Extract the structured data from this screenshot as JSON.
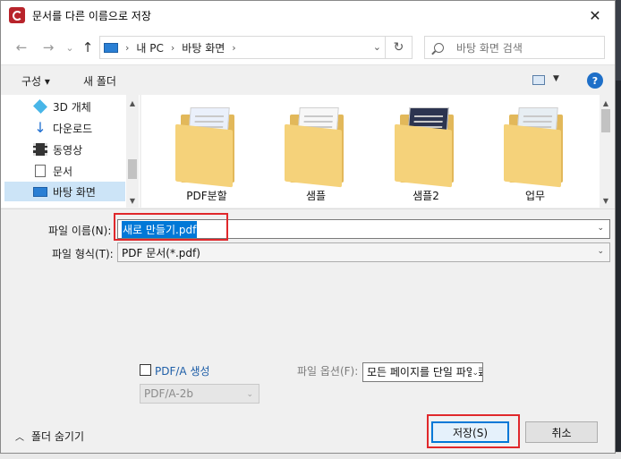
{
  "window": {
    "title": "문서를 다른 이름으로 저장",
    "close": "✕"
  },
  "nav": {
    "back": "←",
    "forward": "→",
    "recent": "⌄",
    "up": "↑",
    "breadcrumb": [
      "내 PC",
      "바탕 화면"
    ],
    "breadcrumb_sep": "›",
    "refresh": "↻",
    "search_placeholder": "바탕 화면 검색"
  },
  "toolbar": {
    "organize_label": "구성 ▾",
    "new_folder_label": "새 폴더",
    "help": "?"
  },
  "sidebar": {
    "items": [
      {
        "label": "3D 개체",
        "icon": "3d-objects-icon"
      },
      {
        "label": "다운로드",
        "icon": "download-icon"
      },
      {
        "label": "동영상",
        "icon": "video-icon"
      },
      {
        "label": "문서",
        "icon": "document-icon"
      },
      {
        "label": "바탕 화면",
        "icon": "desktop-icon",
        "selected": true
      }
    ]
  },
  "folders": [
    {
      "name": "PDF분할"
    },
    {
      "name": "샘플"
    },
    {
      "name": "샘플2"
    },
    {
      "name": "업무"
    }
  ],
  "form": {
    "filename_label": "파일 이름(N):",
    "filename_value": "새로 만들기.pdf",
    "filetype_label": "파일 형식(T):",
    "filetype_value": "PDF 문서(*.pdf)",
    "pdfa_label": "PDF/A 생성",
    "pdfa_value": "PDF/A-2b",
    "options_label": "파일 옵션(F):",
    "options_value": "모든 페이지를 단일 파일로"
  },
  "footer": {
    "hide_folders": "폴더 숨기기",
    "save_label": "저장(S)",
    "cancel_label": "취소"
  },
  "colors": {
    "accent": "#0078d7",
    "highlight_box": "#e0282b",
    "folder": "#f5d27a"
  }
}
